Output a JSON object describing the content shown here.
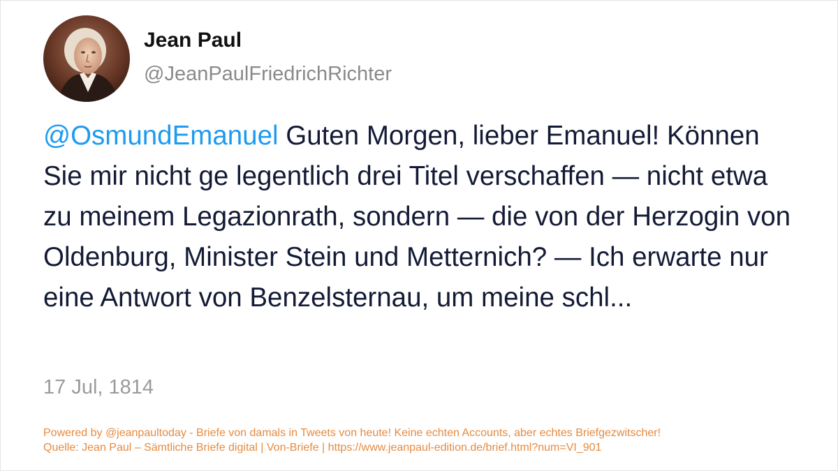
{
  "account": {
    "display_name": "Jean Paul",
    "handle": "@JeanPaulFriedrichRichter",
    "avatar_icon": "portrait-avatar"
  },
  "tweet": {
    "mention": "@OsmundEmanuel",
    "text": " Guten Morgen, lieber Emanuel! Können Sie mir nicht ge legentlich drei Titel verschaffen — nicht etwa zu meinem Legazionrath, sondern — die von der Herzogin von Oldenburg, Minister Stein und Metternich? — Ich erwarte nur eine Antwort von Benzelsternau, um meine schl...",
    "date": "17 Jul, 1814"
  },
  "footer": {
    "line1": "Powered by @jeanpaultoday - Briefe von damals in Tweets von heute! Keine echten Accounts, aber echtes Briefgezwitscher!",
    "line2": "Quelle: Jean Paul – Sämtliche Briefe digital | Von-Briefe | https://www.jeanpaul-edition.de/brief.html?num=VI_901"
  },
  "colors": {
    "mention": "#1d9bf0",
    "text": "#131a35",
    "muted": "#8a8a8a",
    "footer": "#e68a3f"
  }
}
